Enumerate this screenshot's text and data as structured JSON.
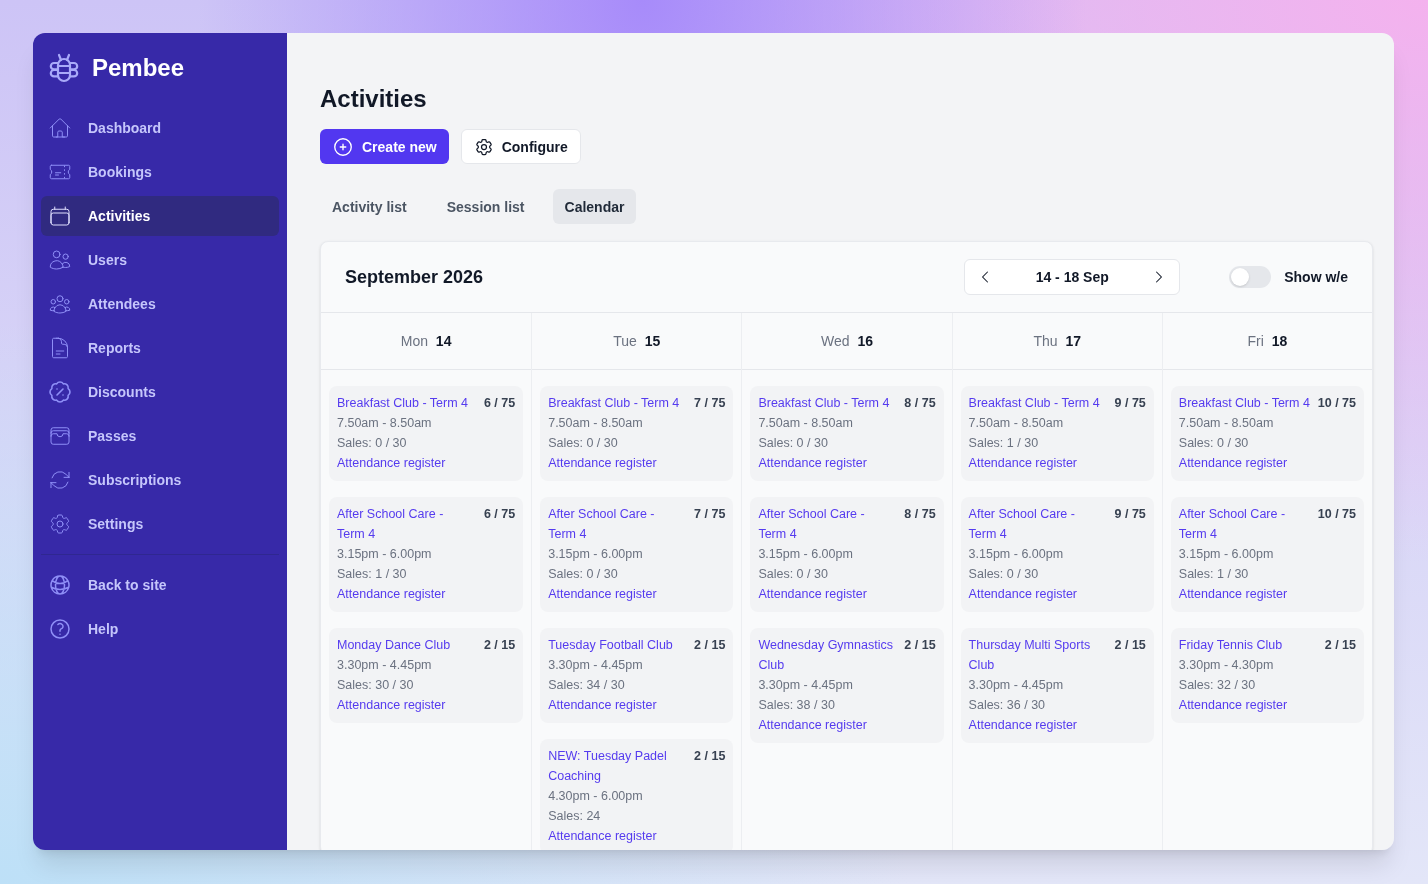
{
  "sidebar": {
    "brand": "Pembee",
    "items": [
      {
        "label": "Dashboard",
        "selected": false
      },
      {
        "label": "Bookings",
        "selected": false
      },
      {
        "label": "Activities",
        "selected": true
      },
      {
        "label": "Users",
        "selected": false
      },
      {
        "label": "Attendees",
        "selected": false
      },
      {
        "label": "Reports",
        "selected": false
      },
      {
        "label": "Discounts",
        "selected": false
      },
      {
        "label": "Passes",
        "selected": false
      },
      {
        "label": "Subscriptions",
        "selected": false
      },
      {
        "label": "Settings",
        "selected": false
      }
    ],
    "footer_items": [
      {
        "label": "Back to site"
      },
      {
        "label": "Help"
      }
    ]
  },
  "header": {
    "title": "Activities",
    "actions": [
      {
        "label": "Create new",
        "kind": "primary"
      },
      {
        "label": "Configure",
        "kind": "secondary"
      }
    ]
  },
  "tabs": [
    {
      "label": "Activity list",
      "selected": false
    },
    {
      "label": "Session list",
      "selected": false
    },
    {
      "label": "Calendar",
      "selected": true
    }
  ],
  "calendar": {
    "title": "September 2026",
    "range": "14 - 18 Sep",
    "weekend_toggle": {
      "label": "Show w/e",
      "on": false
    },
    "days": [
      {
        "weekday": "Mon",
        "date": "14",
        "sessions": [
          {
            "title": "Breakfast Club - Term 4",
            "count": "6 / 75",
            "time": "7.50am - 8.50am",
            "sales": "Sales: 0 / 30",
            "link": "Attendance register"
          },
          {
            "title": "After School Care - Term 4",
            "count": "6 / 75",
            "time": "3.15pm - 6.00pm",
            "sales": "Sales: 1 / 30",
            "link": "Attendance register"
          },
          {
            "title": "Monday Dance Club",
            "count": "2 / 15",
            "time": "3.30pm - 4.45pm",
            "sales": "Sales: 30 / 30",
            "link": "Attendance register"
          }
        ]
      },
      {
        "weekday": "Tue",
        "date": "15",
        "sessions": [
          {
            "title": "Breakfast Club - Term 4",
            "count": "7 / 75",
            "time": "7.50am - 8.50am",
            "sales": "Sales: 0 / 30",
            "link": "Attendance register"
          },
          {
            "title": "After School Care - Term 4",
            "count": "7 / 75",
            "time": "3.15pm - 6.00pm",
            "sales": "Sales: 0 / 30",
            "link": "Attendance register"
          },
          {
            "title": "Tuesday Football Club",
            "count": "2 / 15",
            "time": "3.30pm - 4.45pm",
            "sales": "Sales: 34 / 30",
            "link": "Attendance register"
          },
          {
            "title": "NEW: Tuesday Padel Coaching",
            "count": "2 / 15",
            "time": "4.30pm - 6.00pm",
            "sales": "Sales: 24",
            "link": "Attendance register"
          }
        ]
      },
      {
        "weekday": "Wed",
        "date": "16",
        "sessions": [
          {
            "title": "Breakfast Club - Term 4",
            "count": "8 / 75",
            "time": "7.50am - 8.50am",
            "sales": "Sales: 0 / 30",
            "link": "Attendance register"
          },
          {
            "title": "After School Care - Term 4",
            "count": "8 / 75",
            "time": "3.15pm - 6.00pm",
            "sales": "Sales: 0 / 30",
            "link": "Attendance register"
          },
          {
            "title": "Wednesday Gymnastics Club",
            "count": "2 / 15",
            "time": "3.30pm - 4.45pm",
            "sales": "Sales: 38 / 30",
            "link": "Attendance register"
          }
        ]
      },
      {
        "weekday": "Thu",
        "date": "17",
        "sessions": [
          {
            "title": "Breakfast Club - Term 4",
            "count": "9 / 75",
            "time": "7.50am - 8.50am",
            "sales": "Sales: 1 / 30",
            "link": "Attendance register"
          },
          {
            "title": "After School Care - Term 4",
            "count": "9 / 75",
            "time": "3.15pm - 6.00pm",
            "sales": "Sales: 0 / 30",
            "link": "Attendance register"
          },
          {
            "title": "Thursday Multi Sports Club",
            "count": "2 / 15",
            "time": "3.30pm - 4.45pm",
            "sales": "Sales: 36 / 30",
            "link": "Attendance register"
          }
        ]
      },
      {
        "weekday": "Fri",
        "date": "18",
        "sessions": [
          {
            "title": "Breakfast Club - Term 4",
            "count": "10 / 75",
            "time": "7.50am - 8.50am",
            "sales": "Sales: 0 / 30",
            "link": "Attendance register"
          },
          {
            "title": "After School Care - Term 4",
            "count": "10 / 75",
            "time": "3.15pm - 6.00pm",
            "sales": "Sales: 1 / 30",
            "link": "Attendance register"
          },
          {
            "title": "Friday Tennis Club",
            "count": "2 / 15",
            "time": "3.30pm - 4.30pm",
            "sales": "Sales: 32 / 30",
            "link": "Attendance register"
          }
        ]
      }
    ]
  }
}
